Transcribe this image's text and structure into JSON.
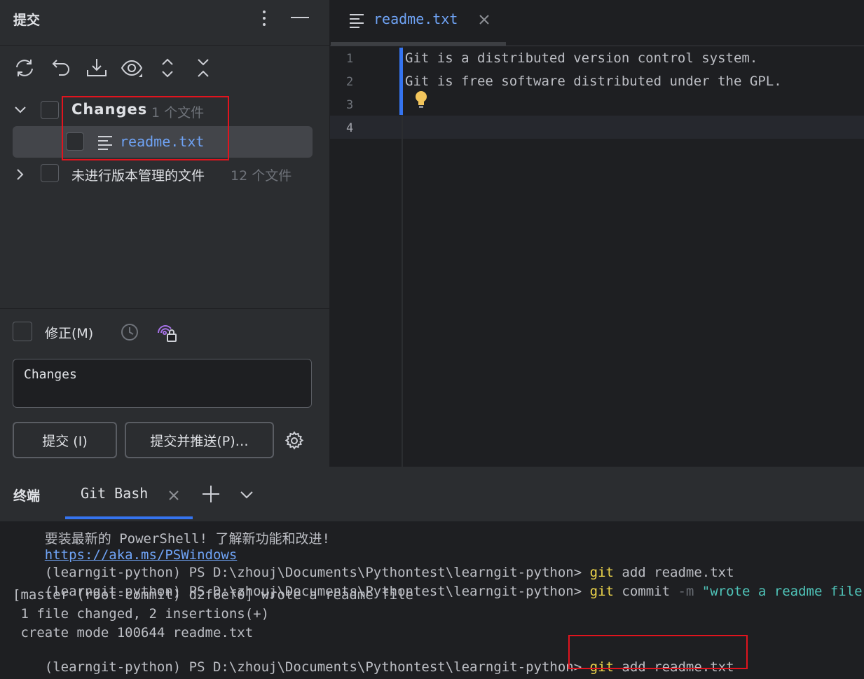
{
  "commit_panel": {
    "title": "提交",
    "changes_group": {
      "label": "Changes",
      "count": "1 个文件"
    },
    "file": {
      "name": "readme.txt"
    },
    "unversioned_group": {
      "label": "未进行版本管理的文件",
      "count": "12 个文件"
    },
    "amend_label": "修正(M)",
    "message": "Changes",
    "commit_button": "提交 (I)",
    "commit_push_button": "提交并推送(P)…"
  },
  "editor": {
    "tab_title": "readme.txt",
    "lines": [
      {
        "no": "1",
        "text": "Git is a distributed version control system."
      },
      {
        "no": "2",
        "text": "Git is free software distributed under the GPL."
      },
      {
        "no": "3",
        "text": ""
      },
      {
        "no": "4",
        "text": ""
      }
    ]
  },
  "terminal": {
    "title": "终端",
    "tab": "Git Bash",
    "partial_line": {
      "text": "要装最新的 PowerShell! 了解新功能和改进!",
      "link": "https://aka.ms/PSWindows"
    },
    "prompt": "(learngit-python) PS D:\\zhouj\\Documents\\Pythontest\\learngit-python> ",
    "lines": [
      {
        "cmd": "git",
        "args": " add readme.txt"
      },
      {
        "cmd": "git",
        "args": " commit ",
        "flag": "-m",
        "str": " \"wrote a readme file\""
      },
      {
        "out": "[master (root-commit) d2f6ef0] wrote a readme file"
      },
      {
        "out": " 1 file changed, 2 insertions(+)"
      },
      {
        "out": " create mode 100644 readme.txt"
      },
      {
        "cmd": "git",
        "args": " add readme.txt"
      }
    ]
  },
  "colors": {
    "highlight_box": "#e1141e",
    "link_blue": "#6fa3f5",
    "cmd_yellow": "#f0d74c",
    "string_teal": "#4fc3b8"
  }
}
